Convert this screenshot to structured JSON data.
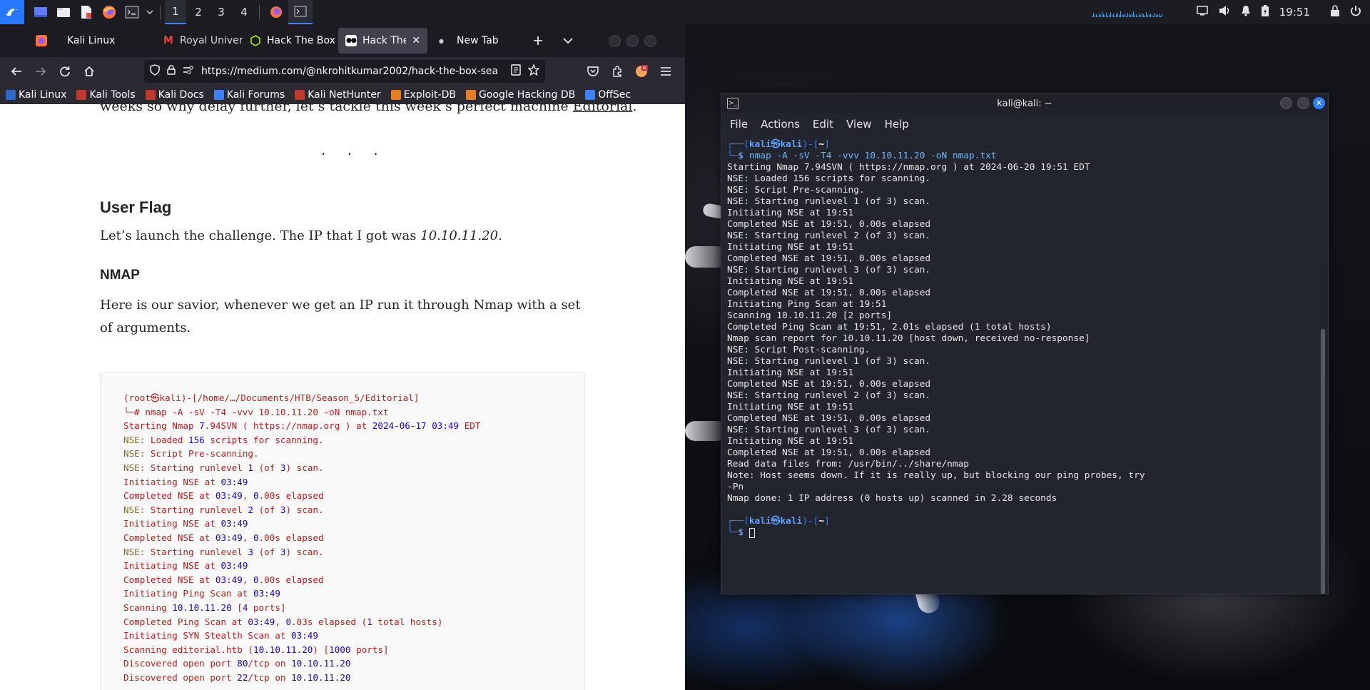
{
  "panel": {
    "workspaces": [
      "1",
      "2",
      "3",
      "4"
    ],
    "active_workspace": "1",
    "clock": "19:51"
  },
  "firefox": {
    "tabs": [
      {
        "label": "Kali Linux",
        "icon": "firefox-icon"
      },
      {
        "label": "Royal Universi",
        "icon": "gmail-icon"
      },
      {
        "label": "Hack The Box",
        "icon": "htb-icon"
      },
      {
        "label": "Hack The Bo",
        "icon": "medium-icon",
        "active": true
      },
      {
        "label": "New Tab",
        "icon": "dot-icon"
      }
    ],
    "url": "https://medium.com/@nkrohitkumar2002/hack-the-box-sea",
    "bookmarks": [
      {
        "label": "Kali Linux",
        "color": "#2a6ac7"
      },
      {
        "label": "Kali Tools",
        "color": "#c0392b"
      },
      {
        "label": "Kali Docs",
        "color": "#c0392b"
      },
      {
        "label": "Kali Forums",
        "color": "#3b82f6"
      },
      {
        "label": "Kali NetHunter",
        "color": "#c0392b"
      },
      {
        "label": "Exploit-DB",
        "color": "#e67e22"
      },
      {
        "label": "Google Hacking DB",
        "color": "#e67e22"
      },
      {
        "label": "OffSec",
        "color": "#3b82f6"
      }
    ]
  },
  "article": {
    "intro_prefix": "weeks so why delay further, let’s tackle this week’s perfect machine ",
    "intro_link": "Editorial",
    "intro_suffix": ".",
    "separator": "· · ·",
    "user_flag_heading": "User Flag",
    "launch_prefix": "Let’s launch the challenge. The IP that I got was ",
    "launch_ip": "10.10.11.20",
    "launch_suffix": ".",
    "nmap_heading": "NMAP",
    "savior_text": "Here is our savior, whenever we get an IP run it through Nmap with a set of arguments.",
    "code_lines": [
      "(root㉿kali)-[/home/…/Documents/HTB/Season_5/Editorial]",
      "└─# nmap -A -sV -T4 -vvv 10.10.11.20 -oN nmap.txt",
      "Starting Nmap 7.94SVN ( https://nmap.org ) at 2024-06-17 03:49 EDT",
      "NSE: Loaded 156 scripts for scanning.",
      "NSE: Script Pre-scanning.",
      "NSE: Starting runlevel 1 (of 3) scan.",
      "Initiating NSE at 03:49",
      "Completed NSE at 03:49, 0.00s elapsed",
      "NSE: Starting runlevel 2 (of 3) scan.",
      "Initiating NSE at 03:49",
      "Completed NSE at 03:49, 0.00s elapsed",
      "NSE: Starting runlevel 3 (of 3) scan.",
      "Initiating NSE at 03:49",
      "Completed NSE at 03:49, 0.00s elapsed",
      "Initiating Ping Scan at 03:49",
      "Scanning 10.10.11.20 [4 ports]",
      "Completed Ping Scan at 03:49, 0.03s elapsed (1 total hosts)",
      "Initiating SYN Stealth Scan at 03:49",
      "Scanning editorial.htb (10.10.11.20) [1000 ports]",
      "Discovered open port 80/tcp on 10.10.11.20",
      "Discovered open port 22/tcp on 10.10.11.20"
    ]
  },
  "terminal": {
    "title": "kali@kali: ~",
    "menu": [
      "File",
      "Actions",
      "Edit",
      "View",
      "Help"
    ],
    "prompt_user": "kali㉿kali",
    "prompt_dir": "~",
    "command": "nmap -A -sV -T4 -vvv 10.10.11.20 -oN nmap.txt",
    "output": [
      "Starting Nmap 7.94SVN ( https://nmap.org ) at 2024-06-20 19:51 EDT",
      "NSE: Loaded 156 scripts for scanning.",
      "NSE: Script Pre-scanning.",
      "NSE: Starting runlevel 1 (of 3) scan.",
      "Initiating NSE at 19:51",
      "Completed NSE at 19:51, 0.00s elapsed",
      "NSE: Starting runlevel 2 (of 3) scan.",
      "Initiating NSE at 19:51",
      "Completed NSE at 19:51, 0.00s elapsed",
      "NSE: Starting runlevel 3 (of 3) scan.",
      "Initiating NSE at 19:51",
      "Completed NSE at 19:51, 0.00s elapsed",
      "Initiating Ping Scan at 19:51",
      "Scanning 10.10.11.20 [2 ports]",
      "Completed Ping Scan at 19:51, 2.01s elapsed (1 total hosts)",
      "Nmap scan report for 10.10.11.20 [host down, received no-response]",
      "NSE: Script Post-scanning.",
      "NSE: Starting runlevel 1 (of 3) scan.",
      "Initiating NSE at 19:51",
      "Completed NSE at 19:51, 0.00s elapsed",
      "NSE: Starting runlevel 2 (of 3) scan.",
      "Initiating NSE at 19:51",
      "Completed NSE at 19:51, 0.00s elapsed",
      "NSE: Starting runlevel 3 (of 3) scan.",
      "Initiating NSE at 19:51",
      "Completed NSE at 19:51, 0.00s elapsed",
      "Read data files from: /usr/bin/../share/nmap",
      "Note: Host seems down. If it is really up, but blocking our ping probes, try",
      "-Pn",
      "Nmap done: 1 IP address (0 hosts up) scanned in 2.28 seconds"
    ]
  },
  "colors": {
    "panel_bg": "#1b1d23",
    "accent": "#3b82f6",
    "code_text": "#c41a16",
    "code_number": "#1c00cf",
    "terminal_bg": "#23252e"
  }
}
